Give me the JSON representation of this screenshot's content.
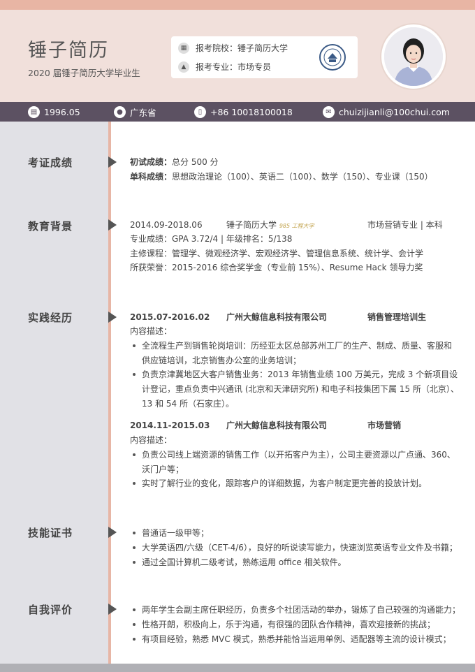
{
  "header": {
    "name": "锤子简历",
    "subtitle": "2020 届锤子简历大学毕业生",
    "apply": [
      {
        "icon": "school-icon",
        "text": "报考院校：锤子简历大学"
      },
      {
        "icon": "graduation-cap-icon",
        "text": "报考专业：市场专员"
      }
    ]
  },
  "contact": {
    "birth": "1996.05",
    "location": "广东省",
    "phone": "+86 10018100018",
    "email": "chuizijianli@100chui.com"
  },
  "sections": {
    "exam": {
      "title": "考证成绩",
      "lines": [
        {
          "label": "初试成绩：",
          "value": "总分 500 分"
        },
        {
          "label": "单科成绩：",
          "value": "思想政治理论（100）、英语二（100）、数学（150）、专业课（150）"
        }
      ]
    },
    "edu": {
      "title": "教育背景",
      "period": "2014.09-2018.06",
      "school": "锤子简历大学",
      "tag": "985 工程大学",
      "major": "市场营销专业 | 本科",
      "lines": [
        "专业成绩：GPA 3.72/4 | 年级排名：5/138",
        "主修课程：管理学、微观经济学、宏观经济学、管理信息系统、统计学、会计学",
        "所获荣誉：2015-2016 综合奖学金（专业前 15%）、Resume Hack 领导力奖"
      ]
    },
    "practice": {
      "title": "实践经历",
      "jobs": [
        {
          "period": "2015.07-2016.02",
          "company": "广州大鲸信息科技有限公司",
          "role": "销售管理培训生",
          "desc_label": "内容描述：",
          "lines": [
            "全流程生产到销售轮岗培训：历经亚太区总部苏州工厂的生产、制成、质量、客服和",
            "供应链培训，北京销售办公室的业务培训；",
            "负责京津冀地区大客户销售业务：2013 年销售业绩 100 万美元，完成 3 个新项目设",
            "计登记，重点负责中兴通讯 (北京和天津研究所) 和电子科技集团下属 15 所（北京）、",
            "13 和 54 所（石家庄）。"
          ]
        },
        {
          "period": "2014.11-2015.03",
          "company": "广州大鲸信息科技有限公司",
          "role": "市场营销",
          "desc_label": "内容描述：",
          "lines": [
            "负责公司线上端资源的销售工作（以开拓客户为主），公司主要资源以广点通、360、",
            "沃门户等；",
            "实时了解行业的变化，跟踪客户的详细数据，为客户制定更完善的投放计划。"
          ]
        }
      ]
    },
    "skills": {
      "title": "技能证书",
      "items": [
        "普通话一级甲等；",
        "大学英语四/六级（CET-4/6），良好的听说读写能力，快速浏览英语专业文件及书籍；",
        "通过全国计算机二级考试，熟练运用 office 相关软件。"
      ]
    },
    "self": {
      "title": "自我评价",
      "items": [
        "两年学生会副主席任职经历，负责多个社团活动的举办，锻炼了自己较强的沟通能力；",
        "性格开朗，积极向上，乐于沟通，有很强的团队合作精神，喜欢迎接新的挑战；",
        "有项目经验，熟悉 MVC 模式，熟悉并能恰当运用单例、适配器等主流的设计模式；"
      ]
    }
  },
  "colors": {
    "accent": "#e7b6a6",
    "header_bg": "#f1e0db",
    "infobar": "#5c5162",
    "sidebar": "#e1e1e6"
  }
}
